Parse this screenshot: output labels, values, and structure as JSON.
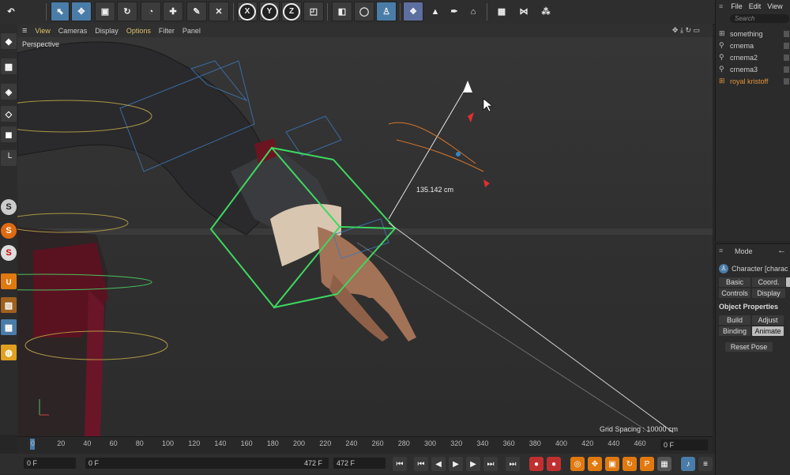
{
  "menu": {
    "file": "File",
    "edit": "Edit",
    "view": "View"
  },
  "viewport_menu": [
    "View",
    "Cameras",
    "Display",
    "Options",
    "Filter",
    "Panel"
  ],
  "viewport": {
    "label": "Perspective",
    "grid_spacing": "Grid Spacing : 10000 cm",
    "distance": "135.142 cm"
  },
  "objects": {
    "search_placeholder": "Search",
    "items": [
      {
        "name": "something",
        "selected": false
      },
      {
        "name": "crnema",
        "selected": false
      },
      {
        "name": "crnema2",
        "selected": false
      },
      {
        "name": "crnema3",
        "selected": false
      },
      {
        "name": "royal kristoff",
        "selected": true
      }
    ]
  },
  "attributes": {
    "mode": "Mode",
    "object_name": "Character [charac",
    "tabs": {
      "basic": "Basic",
      "coord": "Coord.",
      "controls": "Controls",
      "display": "Display"
    },
    "section": "Object Properties",
    "build": "Build",
    "adjust": "Adjust",
    "binding": "Binding",
    "animate": "Animate",
    "reset_pose": "Reset Pose"
  },
  "timeline": {
    "ticks": [
      "0",
      "20",
      "40",
      "60",
      "80",
      "100",
      "120",
      "140",
      "160",
      "180",
      "200",
      "220",
      "240",
      "260",
      "280",
      "300",
      "320",
      "340",
      "360",
      "380",
      "400",
      "420",
      "440",
      "460",
      "4"
    ],
    "current_frame": "0 F"
  },
  "bottom": {
    "start": "0 F",
    "current": "0 F",
    "end_a": "472 F",
    "end_b": "472 F"
  },
  "toolbar_axes": {
    "x": "X",
    "y": "Y",
    "z": "Z"
  },
  "left_s_labels": [
    "S",
    "S",
    "S"
  ]
}
